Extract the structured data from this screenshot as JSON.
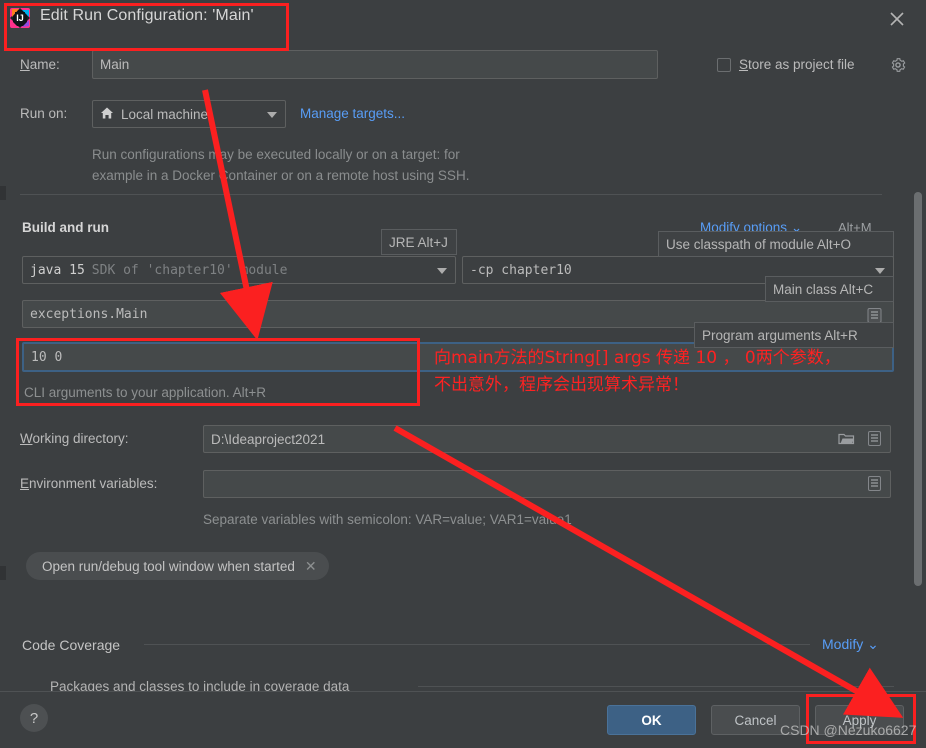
{
  "window": {
    "title": "Edit Run Configuration: 'Main'",
    "logo_icon": "intellij-idea-logo",
    "close_icon": "close-icon"
  },
  "form": {
    "name_label": "Name:",
    "name_value": "Main",
    "store_as_project_file_label": "Store as project file",
    "store_gear_icon": "gear-icon",
    "run_on_label": "Run on:",
    "run_on_value": "Local machine",
    "run_on_icon": "home-icon",
    "manage_targets_link": "Manage targets...",
    "run_on_description": "Run configurations may be executed locally or on a target: for\nexample in a Docker Container or on a remote host using SSH."
  },
  "build_and_run": {
    "section_title": "Build and run",
    "modify_options_link": "Modify options",
    "modify_options_shortcut": "Alt+M",
    "jre_value_bold": "java 15",
    "jre_value_muted": "SDK of 'chapter10' module",
    "classpath_value": "-cp chapter10",
    "main_class_value": "exceptions.Main",
    "program_arguments_value": "10 0",
    "program_arguments_hint": "CLI arguments to your application. Alt+R",
    "expand_icon": "expand-editor-icon"
  },
  "tooltips": [
    {
      "name": "jre-tooltip",
      "text": "JRE Alt+J",
      "key": "J"
    },
    {
      "name": "classpath-tooltip",
      "text": "Use classpath of module Alt+O",
      "key": "O"
    },
    {
      "name": "main-class-tooltip",
      "text": "Main class Alt+C",
      "key": "C"
    },
    {
      "name": "program-arguments-tooltip",
      "text": "Program arguments Alt+R",
      "key": "R"
    }
  ],
  "paths": {
    "working_directory_label": "Working directory:",
    "working_directory_value": "D:\\Ideaproject2021",
    "browse_icon": "folder-icon",
    "macro_icon": "insert-macro-icon",
    "environment_variables_label": "Environment variables:",
    "environment_variables_value": "",
    "environment_hint": "Separate variables with semicolon: VAR=value; VAR1=value1"
  },
  "chips": [
    {
      "label": "Open run/debug tool window when started",
      "remove_icon": "close-icon"
    }
  ],
  "code_coverage": {
    "section_title": "Code Coverage",
    "modify_link": "Modify",
    "packages_label": "Packages and classes to include in coverage data"
  },
  "footer": {
    "help_label": "?",
    "ok_label": "OK",
    "cancel_label": "Cancel",
    "apply_label": "Apply"
  },
  "annotations": {
    "chinese_note": "向main方法的String[] args 传递 10 ， 0两个参数，\n不出意外，程序会出现算术异常！",
    "watermark": "CSDN @Nezuko6627",
    "highlight_color": "#fb2020"
  }
}
